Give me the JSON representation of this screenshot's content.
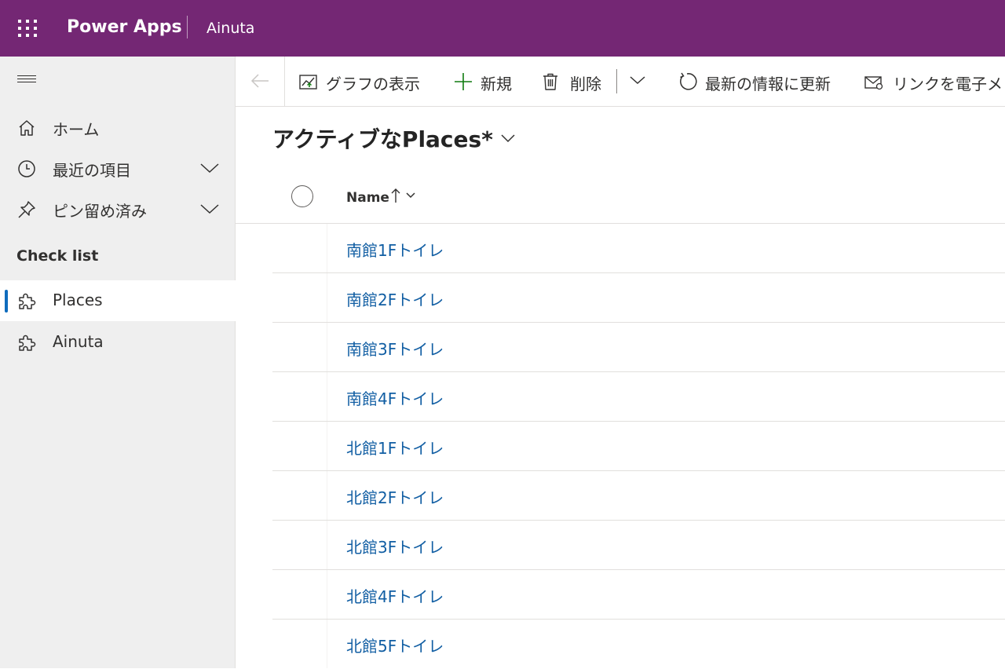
{
  "header": {
    "app_name": "Power Apps",
    "environment": "Ainuta",
    "background": "#742774"
  },
  "sidebar": {
    "nav": [
      {
        "label": "ホーム",
        "icon": "home-icon"
      },
      {
        "label": "最近の項目",
        "icon": "clock-icon",
        "expandable": true
      },
      {
        "label": "ピン留め済み",
        "icon": "pin-icon",
        "expandable": true
      }
    ],
    "group_title": "Check list",
    "entities": [
      {
        "label": "Places",
        "icon": "puzzle-icon",
        "selected": true
      },
      {
        "label": "Ainuta",
        "icon": "puzzle-icon",
        "selected": false
      }
    ]
  },
  "command_bar": {
    "show_chart": "グラフの表示",
    "new": "新規",
    "delete": "削除",
    "refresh": "最新の情報に更新",
    "email_link": "リンクを電子メ"
  },
  "view": {
    "title": "アクティブなPlaces*"
  },
  "grid": {
    "columns": [
      {
        "label": "Name",
        "sort": "ascending"
      }
    ],
    "rows": [
      "南館1Fトイレ",
      "南館2Fトイレ",
      "南館3Fトイレ",
      "南館4Fトイレ",
      "北館1Fトイレ",
      "北館2Fトイレ",
      "北館3Fトイレ",
      "北館4Fトイレ",
      "北館5Fトイレ"
    ]
  },
  "colors": {
    "link": "#115ea3",
    "accent": "#0f6cbd",
    "new_icon": "#107c10"
  }
}
